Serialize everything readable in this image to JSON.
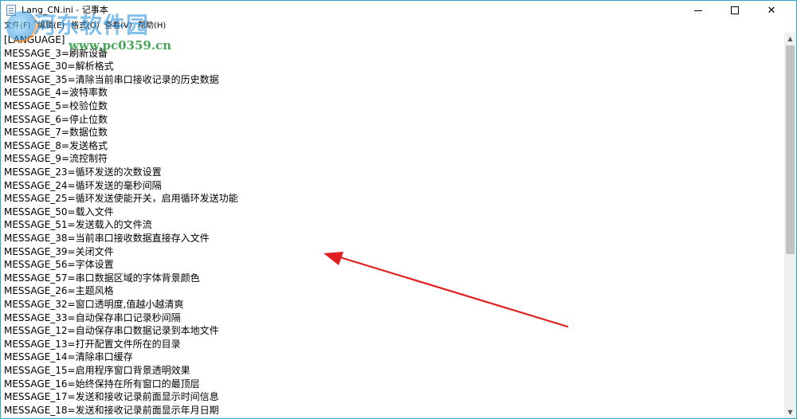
{
  "window": {
    "title": "Lang_CN.ini - 记事本",
    "controls": {
      "minimize": "minimize",
      "maximize": "maximize",
      "close": "✕"
    }
  },
  "menu": {
    "items": [
      "文件(F)",
      "编辑(E)",
      "格式(O)",
      "查看(V)",
      "帮助(H)"
    ]
  },
  "watermark": {
    "site_name": "河东软件园",
    "url": "www.pc0359.cn"
  },
  "editor": {
    "lines": [
      "[LANGUAGE]",
      "MESSAGE_3=刷新设备",
      "MESSAGE_30=解析格式",
      "MESSAGE_35=清除当前串口接收记录的历史数据",
      "MESSAGE_4=波特率数",
      "MESSAGE_5=校验位数",
      "MESSAGE_6=停止位数",
      "MESSAGE_7=数据位数",
      "MESSAGE_8=发送格式",
      "MESSAGE_9=流控制符",
      "MESSAGE_23=循环发送的次数设置",
      "MESSAGE_24=循环发送的毫秒间隔",
      "MESSAGE_25=循环发送使能开关，启用循环发送功能",
      "MESSAGE_50=载入文件",
      "MESSAGE_51=发送载入的文件流",
      "MESSAGE_38=当前串口接收数据直接存入文件",
      "MESSAGE_39=关闭文件",
      "MESSAGE_56=字体设置",
      "MESSAGE_57=串口数据区域的字体背景颜色",
      "MESSAGE_26=主题风格",
      "MESSAGE_32=窗口透明度,值越小越清爽",
      "MESSAGE_33=自动保存串口记录秒间隔",
      "MESSAGE_12=自动保存串口数据记录到本地文件",
      "MESSAGE_13=打开配置文件所在的目录",
      "MESSAGE_14=清除串口缓存",
      "MESSAGE_15=启用程序窗口背景透明效果",
      "MESSAGE_16=始终保持在所有窗口的最顶层",
      "MESSAGE_17=发送和接收记录前面显示时间信息",
      "MESSAGE_18=发送和接收记录前面显示年月日期"
    ]
  },
  "scrollbar": {
    "up_icon": "chevron-up-icon",
    "down_icon": "chevron-down-icon",
    "position_fraction": 0.0,
    "visible_fraction": 0.58
  },
  "annotation": {
    "arrow_color": "#e02020"
  },
  "colors": {
    "window_border": "#2aa7c9",
    "text": "#000000",
    "scrollbar_track": "#f0f0f0",
    "scrollbar_thumb": "#c2c2c2"
  }
}
